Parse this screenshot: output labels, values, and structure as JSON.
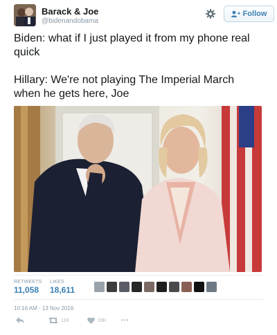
{
  "header": {
    "display_name": "Barack & Joe",
    "handle": "@bidenandobama",
    "follow_label": "Follow"
  },
  "tweet": {
    "paragraphs": [
      "Biden: what if I just played it from my phone real quick",
      "Hillary: We're not playing The Imperial March when he gets here, Joe"
    ]
  },
  "stats": {
    "retweets_label": "RETWEETS",
    "retweets_value": "11,058",
    "likes_label": "LIKES",
    "likes_value": "18,611"
  },
  "timestamp": "10:16 AM - 13 Nov 2016",
  "actions": {
    "retweet_count": "11K",
    "like_count": "19K",
    "more_glyph": "•••"
  },
  "icons": {
    "gear": "gear-icon",
    "follow": "add-user-icon",
    "reply": "reply-icon",
    "retweet": "retweet-icon",
    "like": "heart-icon",
    "more": "more-icon"
  },
  "colors": {
    "link_blue": "#3b7fb4",
    "muted_gray": "#8899a6",
    "text": "#14171a"
  }
}
